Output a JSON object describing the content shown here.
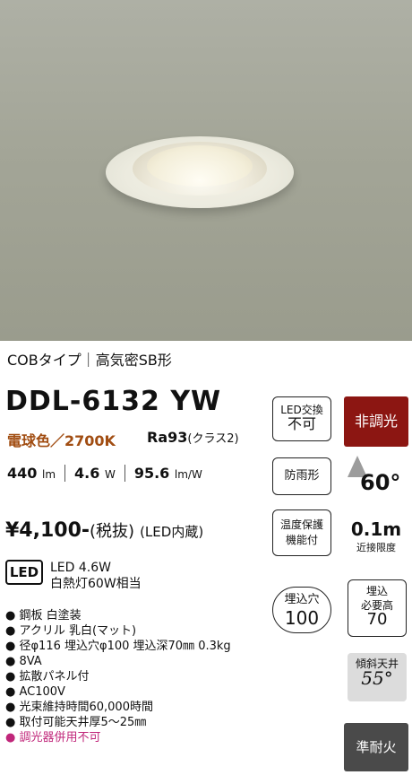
{
  "category": "COBタイプ｜高気密SB形",
  "model": "DDL-6132 YW",
  "color_temp": "電球色／2700K",
  "ra": "Ra93",
  "ra_class": "(クラス2)",
  "specs": {
    "lumen": "440",
    "lumen_unit": "lm",
    "watt": "4.6",
    "watt_unit": "W",
    "efficacy": "95.6",
    "efficacy_unit": "lm/W"
  },
  "price": {
    "amount": "¥4,100-",
    "tax": "(税抜)",
    "led_note": "(LED内蔵)"
  },
  "led_badge": "LED",
  "led_spec": {
    "line1": "LED 4.6W",
    "line2": "白熱灯60W相当"
  },
  "features": [
    "● 鋼板 白塗装",
    "● アクリル 乳白(マット)",
    "● 径φ116 埋込穴φ100 埋込深70㎜ 0.3kg",
    "● 8VA",
    "● 拡散パネル付",
    "● AC100V",
    "● 光束維持時間60,000時間",
    "● 取付可能天井厚5～25㎜",
    "● 調光器併用不可"
  ],
  "badges": {
    "led_replace_line1": "LED交換",
    "led_replace_line2": "不可",
    "rainproof": "防雨形",
    "thermal_line1": "温度保護",
    "thermal_line2": "機能付",
    "hole_label": "埋込穴",
    "hole_value": "100",
    "non_dimming": "非調光",
    "beam_angle": "60°",
    "distance_value": "0.1m",
    "distance_label": "近接限度",
    "depth_line1": "埋込",
    "depth_line2": "必要高",
    "depth_value": "70",
    "tilt_label": "傾斜天井",
    "tilt_value": "55°",
    "fireproof": "準耐火"
  },
  "colors": {
    "accent": "#a14d12",
    "non_dimming_bg": "#8c1612",
    "warning": "#c0267a",
    "fire_bg": "#4a4a4a"
  }
}
